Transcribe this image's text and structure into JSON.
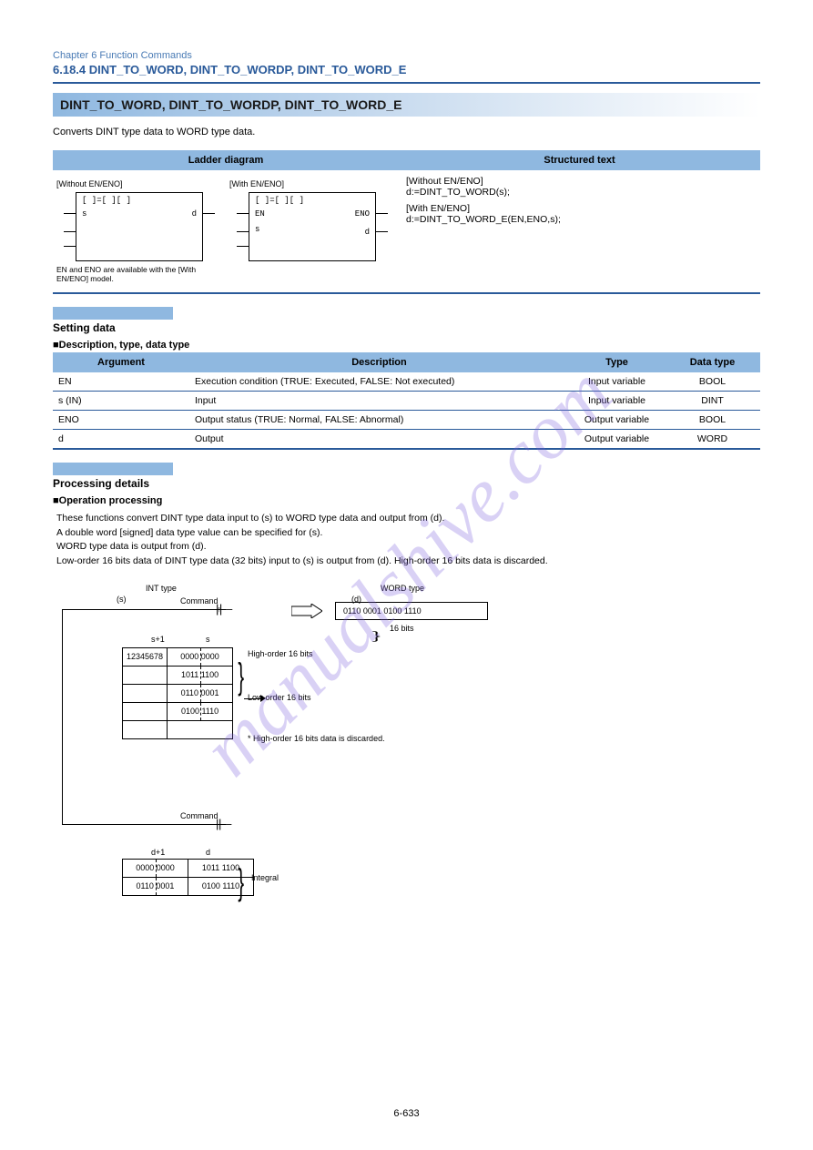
{
  "chapter": "Chapter 6 Function Commands",
  "section_link": "6.18.4 DINT_TO_WORD, DINT_TO_WORDP, DINT_TO_WORD_E",
  "title_band": "DINT_TO_WORD, DINT_TO_WORDP, DINT_TO_WORD_E",
  "intro": "Converts DINT type data to WORD type data.",
  "ladder_header": "Ladder diagram",
  "st_header": "Structured text",
  "ladder": {
    "without_en": {
      "title": "[Without EN/ENO]",
      "rows": [
        "s",
        "",
        ""
      ],
      "out": "d"
    },
    "with_en": {
      "title": "[With EN/ENO]",
      "rows": [
        "EN",
        "s",
        ""
      ],
      "out": "ENO",
      "out2": "d"
    },
    "note": "EN and ENO are available with the [With EN/ENO] model."
  },
  "st_line1": "[Without EN/ENO]",
  "st_code1": "d:=DINT_TO_WORD(s);",
  "st_line2": "[With EN/ENO]",
  "st_code2": "d:=DINT_TO_WORD_E(EN,ENO,s);",
  "param_section": "Setting data",
  "param_sub1": "■Description, type, data type",
  "params_header": {
    "arg": "Argument",
    "desc": "Description",
    "type": "Type",
    "dtype": "Data type"
  },
  "params": [
    {
      "arg": "EN",
      "desc": "Execution condition (TRUE: Executed, FALSE: Not executed)",
      "type": "Input variable",
      "dtype": "BOOL"
    },
    {
      "arg": "s (IN)",
      "desc": "Input",
      "type": "Input variable",
      "dtype": "DINT"
    },
    {
      "arg": "ENO",
      "desc": "Output status (TRUE: Normal, FALSE: Abnormal)",
      "type": "Output variable",
      "dtype": "BOOL"
    },
    {
      "arg": "d",
      "desc": "Output",
      "type": "Output variable",
      "dtype": "WORD"
    }
  ],
  "proc_section": "Processing details",
  "proc_sub": "■Operation processing",
  "proc_bullets": [
    "These functions convert DINT type data input to (s) to WORD type data and output from (d).",
    "A double word [signed] data type value can be specified for (s).",
    "WORD type data is output from (d).",
    "Low-order 16 bits data of DINT type data (32 bits) input to (s) is output from (d). High-order 16 bits data is discarded."
  ],
  "diagram": {
    "input_label": "INT type",
    "output_label": "WORD type",
    "s_sym": "(s)",
    "d_sym": "(d)",
    "cmd_line": "Command",
    "p_line": "Command",
    "s_table_header_a": "s+1",
    "s_table_header_b": "s",
    "high_label": "High-order 16 bits",
    "low_label": "Low-order 16 bits",
    "s_rows": [
      {
        "addr": "12345678",
        "hi": "0000 0000",
        "lo": "1011 1100"
      },
      {
        "addr": "",
        "hi": "0110 0001",
        "lo": "0100 1110"
      }
    ],
    "out_box": "0110 0001 0100 1110",
    "d_under": "16 bits",
    "discard_note": "* High-order 16 bits data is discarded.",
    "d_table_header_a": "d+1",
    "d_table_header_b": "d",
    "d_rows": [
      {
        "hi": "0000 0000",
        "lo": "1011 1100"
      },
      {
        "hi": "0110 0001",
        "lo": "0100 1110"
      }
    ],
    "integral": "Integral"
  },
  "page": "6-633"
}
